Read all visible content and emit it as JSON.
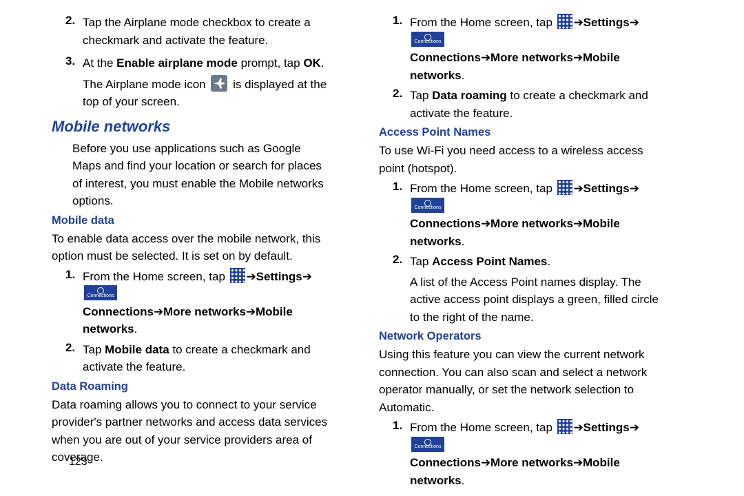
{
  "left": {
    "step2": {
      "num": "2.",
      "text": "Tap the Airplane mode checkbox to create a checkmark and activate the feature."
    },
    "step3": {
      "num": "3.",
      "pre": "At the ",
      "bold1": "Enable airplane mode",
      "mid": " prompt, tap ",
      "bold2": "OK",
      "post": ".",
      "line2_a": "The Airplane mode icon ",
      "line2_b": " is displayed at the top of your screen."
    },
    "mobile_networks_title": "Mobile networks",
    "mobile_networks_body": "Before you use applications such as Google Maps and find your location or search for places of interest, you must enable the Mobile networks options.",
    "mobile_data_title": "Mobile data",
    "mobile_data_body": "To enable data access over the mobile network, this option must be selected. It is set on by default.",
    "md_step1": {
      "num": "1.",
      "from_home": "From the Home screen, tap ",
      "arrow": " ➔ ",
      "settings": "Settings",
      "connections_lbl": "Connections",
      "more_networks": "More networks",
      "mobile_networks": "Mobile networks",
      "end": "."
    },
    "md_step2": {
      "num": "2.",
      "a": "Tap ",
      "b": "Mobile data",
      "c": " to create a checkmark and activate the feature."
    },
    "data_roaming_title": "Data Roaming",
    "data_roaming_body": "Data roaming allows you to connect to your service provider's partner networks and access data services when you are out of your service providers area of coverage."
  },
  "right": {
    "dr_step1": {
      "num": "1.",
      "from_home": "From the Home screen, tap ",
      "arrow": " ➔ ",
      "settings": "Settings",
      "connections_lbl": "Connections",
      "more_networks": "More networks",
      "mobile_networks": "Mobile networks",
      "end": "."
    },
    "dr_step2": {
      "num": "2.",
      "a": "Tap ",
      "b": "Data roaming",
      "c": " to create a checkmark and activate the feature."
    },
    "apn_title": "Access Point Names",
    "apn_body": "To use Wi-Fi you need access to a wireless access point (hotspot).",
    "apn_step1": {
      "num": "1.",
      "from_home": "From the Home screen, tap ",
      "arrow": " ➔ ",
      "settings": "Settings",
      "connections_lbl": "Connections",
      "more_networks": "More networks",
      "mobile_networks": "Mobile networks",
      "end": "."
    },
    "apn_step2": {
      "num": "2.",
      "a": "Tap ",
      "b": "Access Point Names",
      "c": ".",
      "d": "A list of the Access Point names display. The active access point displays a green, filled circle to the right of the name."
    },
    "no_title": "Network Operators",
    "no_body": "Using this feature you can view the current network connection. You can also scan and select a network operator manually, or set the network selection to Automatic.",
    "no_step1": {
      "num": "1.",
      "from_home": "From the Home screen, tap ",
      "arrow": " ➔ ",
      "settings": "Settings",
      "connections_lbl": "Connections",
      "more_networks": "More networks",
      "mobile_networks": "Mobile networks",
      "end": "."
    }
  },
  "page_number": "123",
  "icon_labels": {
    "connections": "Connections"
  }
}
